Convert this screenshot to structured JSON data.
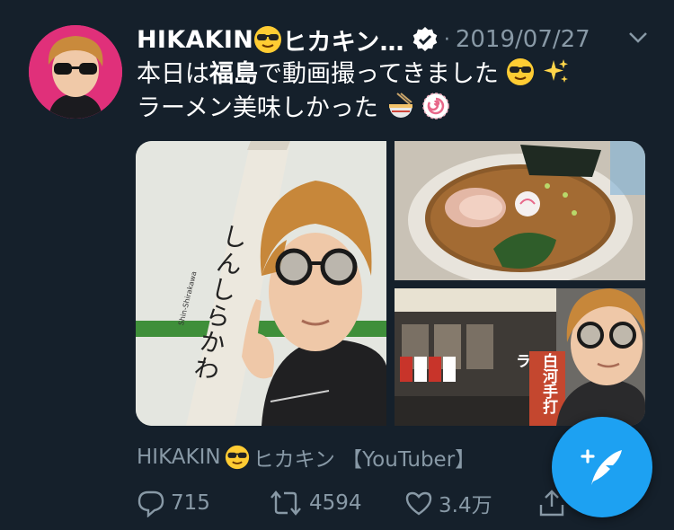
{
  "tweet": {
    "author_name": "HIKAKIN",
    "author_name_rest": "ヒカキン…",
    "date": "2019/07/27",
    "text_line1_a": "本日は",
    "text_line1_bold": "福島",
    "text_line1_b": "で動画撮ってきました",
    "text_line2": "ラーメン美味しかった",
    "media": [
      {
        "desc": "station-sign-selfie"
      },
      {
        "desc": "ramen-bowl"
      },
      {
        "desc": "ramen-shop-selfie"
      }
    ],
    "source_name": "HIKAKIN",
    "source_rest": "ヒカキン 【YouTuber】",
    "replies": "715",
    "retweets": "4594",
    "likes": "3.4万"
  },
  "photo_text": {
    "sign_kana": "しんしらかわ",
    "sign_romaji": "Shin-Shirakawa",
    "shop_banner": "白河手打ラ"
  },
  "colors": {
    "background": "#15202b",
    "muted": "#8899a6",
    "accent": "#1da1f2",
    "avatar_bg": "#e0307a"
  },
  "icons": [
    "sunglasses-emoji-icon",
    "verified-badge-icon",
    "chevron-down-icon",
    "sparkles-emoji-icon",
    "ramen-emoji-icon",
    "fishcake-emoji-icon",
    "reply-icon",
    "retweet-icon",
    "like-icon",
    "share-icon",
    "compose-tweet-icon"
  ]
}
